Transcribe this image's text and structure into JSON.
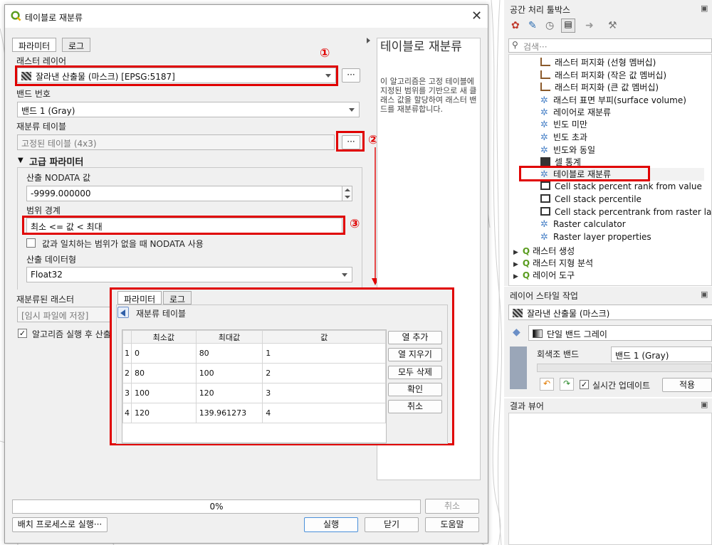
{
  "dialog": {
    "title": "테이블로 재분류",
    "tabs": [
      "파라미터",
      "로그"
    ],
    "raster_layer_label": "래스터 레이어",
    "raster_layer_value": "잘라낸 산출물 (마스크) [EPSG:5187]",
    "band_label": "밴드 번호",
    "band_value": "밴드 1 (Gray)",
    "reclass_table_label": "재분류 테이블",
    "reclass_table_value": "고정된 테이블 (4x3)",
    "advanced_label": "고급 파라미터",
    "nodata_label": "산출 NODATA 값",
    "nodata_value": "-9999.000000",
    "range_label": "범위 경계",
    "range_value": "최소 <= 값 < 최대",
    "nodata_check_label": "값과 일치하는 범위가 없을 때 NODATA 사용",
    "output_type_label": "산출 데이터형",
    "output_type_value": "Float32",
    "reclassified_label": "재분류된 래스터",
    "reclassified_value": "[임시 파일에 저장]",
    "open_after_label": "알고리즘 실행 후 산출",
    "progress_text": "0%",
    "cancel_label": "취소",
    "batch_label": "배치 프로세스로 실행···",
    "run_label": "실행",
    "close_label": "닫기",
    "help_label": "도움말",
    "ellipsis": "···",
    "markers": [
      "①",
      "②",
      "③"
    ]
  },
  "help_panel": {
    "title": "테이블로 재분류",
    "body": "이 알고리즘은 고정 테이블에 지정된 범위를 기반으로 새 클래스 값을 할당하여 래스터 밴드를 재분류합니다."
  },
  "popup": {
    "tabs": [
      "파라미터",
      "로그"
    ],
    "title": "재분류 테이블",
    "columns": [
      "최소값",
      "최대값",
      "값"
    ],
    "rows": [
      {
        "n": "1",
        "min": "0",
        "max": "80",
        "val": "1"
      },
      {
        "n": "2",
        "min": "80",
        "max": "100",
        "val": "2"
      },
      {
        "n": "3",
        "min": "100",
        "max": "120",
        "val": "3"
      },
      {
        "n": "4",
        "min": "120",
        "max": "139.961273",
        "val": "4"
      }
    ],
    "buttons": [
      "열 추가",
      "열 지우기",
      "모두 삭제",
      "확인",
      "취소"
    ]
  },
  "toolbox": {
    "title": "공간 처리 툴박스",
    "search_placeholder": "검색···",
    "items": [
      "래스터 퍼지화 (선형 멤버십)",
      "래스터 퍼지화 (작은 값 멤버십)",
      "래스터 퍼지화 (큰 값 멤버십)",
      "래스터 표면 부피(surface volume)",
      "레이어로 재분류",
      "빈도 미만",
      "빈도 초과",
      "빈도와 동일",
      "셀 통계",
      "테이블로 재분류",
      "Cell stack percent rank from value",
      "Cell stack percentile",
      "Cell stack percentrank from raster layer",
      "Raster calculator",
      "Raster layer properties"
    ],
    "groups": [
      "래스터 생성",
      "래스터 지형 분석",
      "레이어 도구"
    ]
  },
  "layer_style": {
    "title": "레이어 스타일 작업",
    "layer_value": "잘라낸 산출물 (마스크)",
    "render_value": "단일 밴드 그레이",
    "gray_band_label": "회색조 밴드",
    "gray_band_value": "밴드 1 (Gray)",
    "live_update_label": "실시간 업데이트",
    "apply_label": "적용"
  },
  "results": {
    "title": "결과 뷰어"
  },
  "colors": {
    "annotation_red": "#e00000",
    "qgis_green": "#5a9c1f",
    "button_blue": "#4a90d9"
  }
}
